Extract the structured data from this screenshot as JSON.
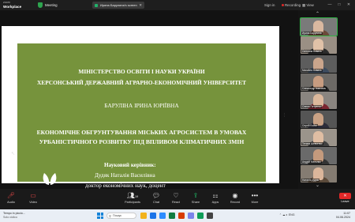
{
  "topbar": {
    "app_line1": "zoom",
    "app_line2": "Workplace",
    "meeting_label": "Meeting",
    "share_status": "Ирина Барулина's screen",
    "sign_in": "Sign in",
    "recording": "Recording",
    "view_label": "View",
    "window_controls": [
      "—",
      "□",
      "✕"
    ]
  },
  "slide": {
    "background_color": "#76933c",
    "ministry": "МІНІСТЕРСТВО ОСВІТИ І НАУКИ УКРАЇНИ",
    "university": "ХЕРСОНСЬКИЙ ДЕРЖАВНИЙ АГРАРНО-ЕКОНОМІЧНИЙ УНІВЕРСИТЕТ",
    "author": "БАРУЛІНА ІРИНА ЮРІЇВНА",
    "title_line1": "ЕКОНОМІЧНЕ ОБГРУНТУВАННЯ МІСЬКИХ АГРОСИСТЕМ В УМОВАХ",
    "title_line2": "УРБАНІСТИЧНОГО РОЗВИТКУ ПІД ВПЛИВОМ КЛІМАТИЧНИХ ЗМІН",
    "supervisor_label": "Науковий керівник:",
    "supervisor_name": "Дудяк Наталія Василівна",
    "supervisor_degree": "доктор економічних наук, доцент"
  },
  "participants": [
    {
      "name": "Ирина Барулина",
      "skin": "#d9b8a0",
      "clothes": "#6b4a3a",
      "bg": "#7a7a7a",
      "active": true
    },
    {
      "name": "Світлана Коваль",
      "skin": "#e1c2a8",
      "clothes": "#2b2b2b",
      "bg": "#9a8f84",
      "active": false
    },
    {
      "name": "Михайло Коваль",
      "skin": "#caa58c",
      "clothes": "#3c4b5e",
      "bg": "#5d5d5d",
      "active": false
    },
    {
      "name": "Олександр Іванович",
      "skin": "#c79c80",
      "clothes": "#222",
      "bg": "#6d6a66",
      "active": false
    },
    {
      "name": "Олена Петренко",
      "skin": "#dcb89c",
      "clothes": "#7a2630",
      "bg": "#8a8580",
      "active": false
    },
    {
      "name": "Сергій Бойко",
      "skin": "#c9a184",
      "clothes": "#2d2d3a",
      "bg": "#555",
      "active": false
    },
    {
      "name": "Тетяна Шевченко",
      "skin": "#e0bea3",
      "clothes": "#404040",
      "bg": "#9b948b",
      "active": false
    },
    {
      "name": "Андрій Мельник",
      "skin": "#c49a7d",
      "clothes": "#333",
      "bg": "#6a6a6a",
      "active": false
    },
    {
      "name": "Наталія Дудяк",
      "skin": "#dbb69b",
      "clothes": "#5b4a3a",
      "bg": "#857c72",
      "active": false
    }
  ],
  "toolbar": {
    "audio": "Audio",
    "video": "Video",
    "participants": "Participants",
    "participants_count": "19",
    "chat": "Chat",
    "react": "React",
    "share": "Share",
    "apps": "Apps",
    "record": "Record",
    "more": "More",
    "leave": "Leave"
  },
  "taskbar": {
    "weather_line1": "Tempo in piccio...",
    "weather_line2": "Solo ciclico",
    "search_placeholder": "Пошук",
    "tray_text": "ENG",
    "time": "11:07",
    "date": "04.06.2024",
    "app_colors": [
      "#f2b21c",
      "#1a73e8",
      "#2d8cff",
      "#107c41",
      "#d83b01",
      "#7b83eb",
      "#0f9d58",
      "#444"
    ]
  }
}
